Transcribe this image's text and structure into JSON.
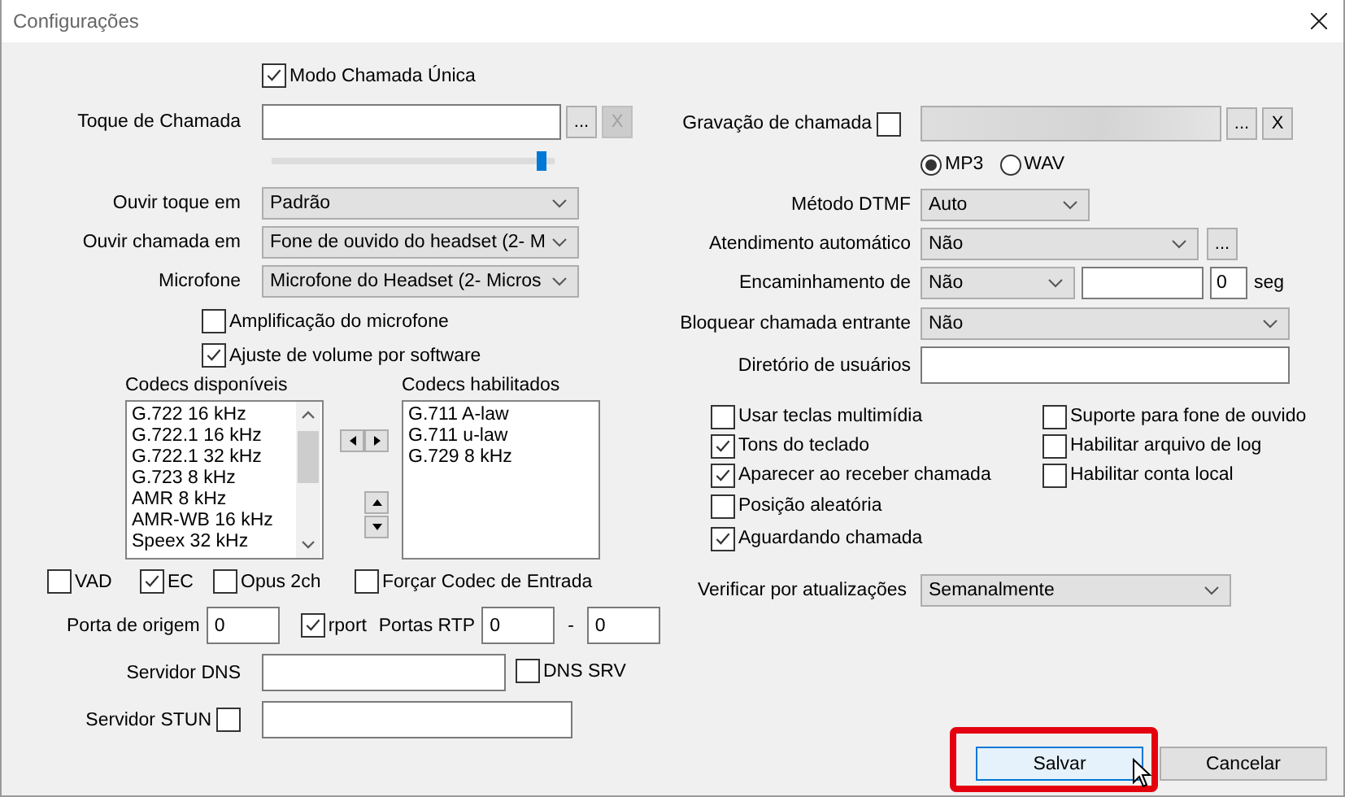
{
  "window": {
    "title": "Configurações"
  },
  "single_call_mode": {
    "label": "Modo Chamada Única",
    "checked": true
  },
  "ringtone": {
    "label": "Toque de Chamada",
    "browse": "...",
    "clear": "X",
    "clear_disabled": true,
    "level": 0.97
  },
  "audio_selects": [
    {
      "label": "Ouvir toque em",
      "value": "Padrão"
    },
    {
      "label": "Ouvir chamada em",
      "value": "Fone de ouvido do headset (2- M"
    },
    {
      "label": "Microfone",
      "value": "Microfone do Headset (2- Micros"
    }
  ],
  "mic_options": [
    {
      "label": "Amplificação do microfone",
      "checked": false
    },
    {
      "label": "Ajuste de volume por software",
      "checked": true
    }
  ],
  "codecs_available": {
    "label": "Codecs disponíveis",
    "items": [
      "G.722 16 kHz",
      "G.722.1 16 kHz",
      "G.722.1 32 kHz",
      "G.723 8 kHz",
      "AMR 8 kHz",
      "AMR-WB 16 kHz",
      "Speex 32 kHz"
    ]
  },
  "codecs_enabled": {
    "label": "Codecs habilitados",
    "items": [
      "G.711 A-law",
      "G.711 u-law",
      "G.729 8 kHz"
    ]
  },
  "codec_options": [
    {
      "label": "VAD",
      "checked": false
    },
    {
      "label": "EC",
      "checked": true
    },
    {
      "label": "Opus 2ch",
      "checked": false
    },
    {
      "label": "Forçar Codec de Entrada",
      "checked": false
    }
  ],
  "source_port": {
    "label": "Porta de origem",
    "value": "0"
  },
  "rport": {
    "label": "rport",
    "checked": true
  },
  "rtp_ports": {
    "label": "Portas RTP",
    "from": "0",
    "separator": "-",
    "to": "0"
  },
  "dns_server": {
    "label": "Servidor DNS"
  },
  "dns_srv": {
    "label": "DNS SRV",
    "checked": false
  },
  "stun_server": {
    "label": "Servidor STUN",
    "checked": false
  },
  "call_recording": {
    "label": "Gravação de chamada",
    "checked": false,
    "browse": "...",
    "clear": "X"
  },
  "formats": [
    {
      "label": "MP3",
      "selected": true
    },
    {
      "label": "WAV",
      "selected": false
    }
  ],
  "dtmf": {
    "label": "Método DTMF",
    "value": "Auto"
  },
  "auto_answer": {
    "label": "Atendimento automático",
    "value": "Não",
    "more": "..."
  },
  "forwarding": {
    "label": "Encaminhamento de",
    "value": "Não",
    "seconds": "0",
    "unit": "seg"
  },
  "block_incoming": {
    "label": "Bloquear chamada entrante",
    "value": "Não"
  },
  "user_directory": {
    "label": "Diretório de usuários"
  },
  "options_left": [
    {
      "label": "Usar teclas multimídia",
      "checked": false
    },
    {
      "label": "Tons do teclado",
      "checked": true
    },
    {
      "label": "Aparecer ao receber chamada",
      "checked": true
    },
    {
      "label": "Posição aleatória",
      "checked": false
    },
    {
      "label": "Aguardando chamada",
      "checked": true
    }
  ],
  "options_right": [
    {
      "label": "Suporte para fone de ouvido",
      "checked": false
    },
    {
      "label": "Habilitar arquivo de log",
      "checked": false
    },
    {
      "label": "Habilitar conta local",
      "checked": false
    }
  ],
  "update_check": {
    "label": "Verificar por atualizações",
    "value": "Semanalmente"
  },
  "buttons": [
    {
      "label": "Salvar",
      "focused": true,
      "highlighted": true
    },
    {
      "label": "Cancelar",
      "focused": false,
      "highlighted": false
    }
  ]
}
